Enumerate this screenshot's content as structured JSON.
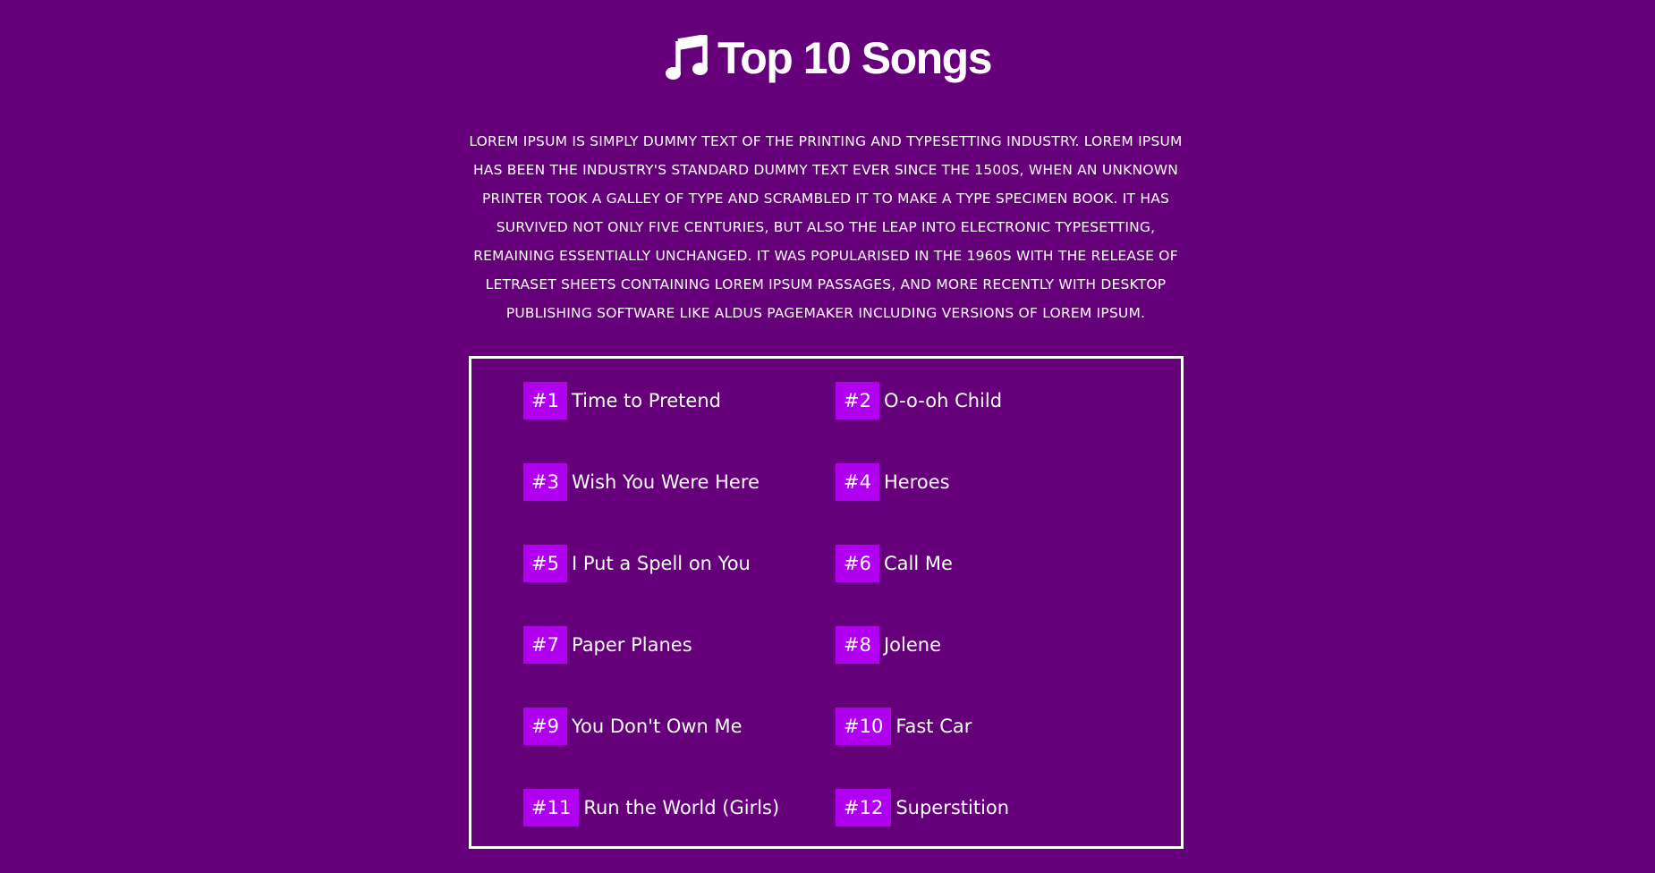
{
  "header": {
    "title": "Top 10 Songs",
    "icon": "music-note-icon"
  },
  "intro": {
    "text": "Lorem Ipsum is simply dummy text of the printing and typesetting industry. Lorem Ipsum has been the industry's standard dummy text ever since the 1500s, when an unknown printer took a galley of type and scrambled it to make a type specimen book. It has survived not only five centuries, but also the leap into electronic typesetting, remaining essentially unchanged. It was popularised in the 1960s with the release of Letraset sheets containing Lorem Ipsum passages, and more recently with desktop publishing software like Aldus PageMaker including versions of Lorem Ipsum."
  },
  "colors": {
    "background": "#66007a",
    "rank_badge": "#b100f0",
    "text": "#ffffff",
    "border": "#ffffff"
  },
  "songs": [
    {
      "rank": "#1",
      "title": "Time to Pretend"
    },
    {
      "rank": "#2",
      "title": "O-o-oh Child"
    },
    {
      "rank": "#3",
      "title": "Wish You Were Here"
    },
    {
      "rank": "#4",
      "title": "Heroes"
    },
    {
      "rank": "#5",
      "title": "I Put a Spell on You"
    },
    {
      "rank": "#6",
      "title": "Call Me"
    },
    {
      "rank": "#7",
      "title": "Paper Planes"
    },
    {
      "rank": "#8",
      "title": "Jolene"
    },
    {
      "rank": "#9",
      "title": "You Don't Own Me"
    },
    {
      "rank": "#10",
      "title": "Fast Car"
    },
    {
      "rank": "#11",
      "title": "Run the World (Girls)"
    },
    {
      "rank": "#12",
      "title": "Superstition"
    }
  ]
}
